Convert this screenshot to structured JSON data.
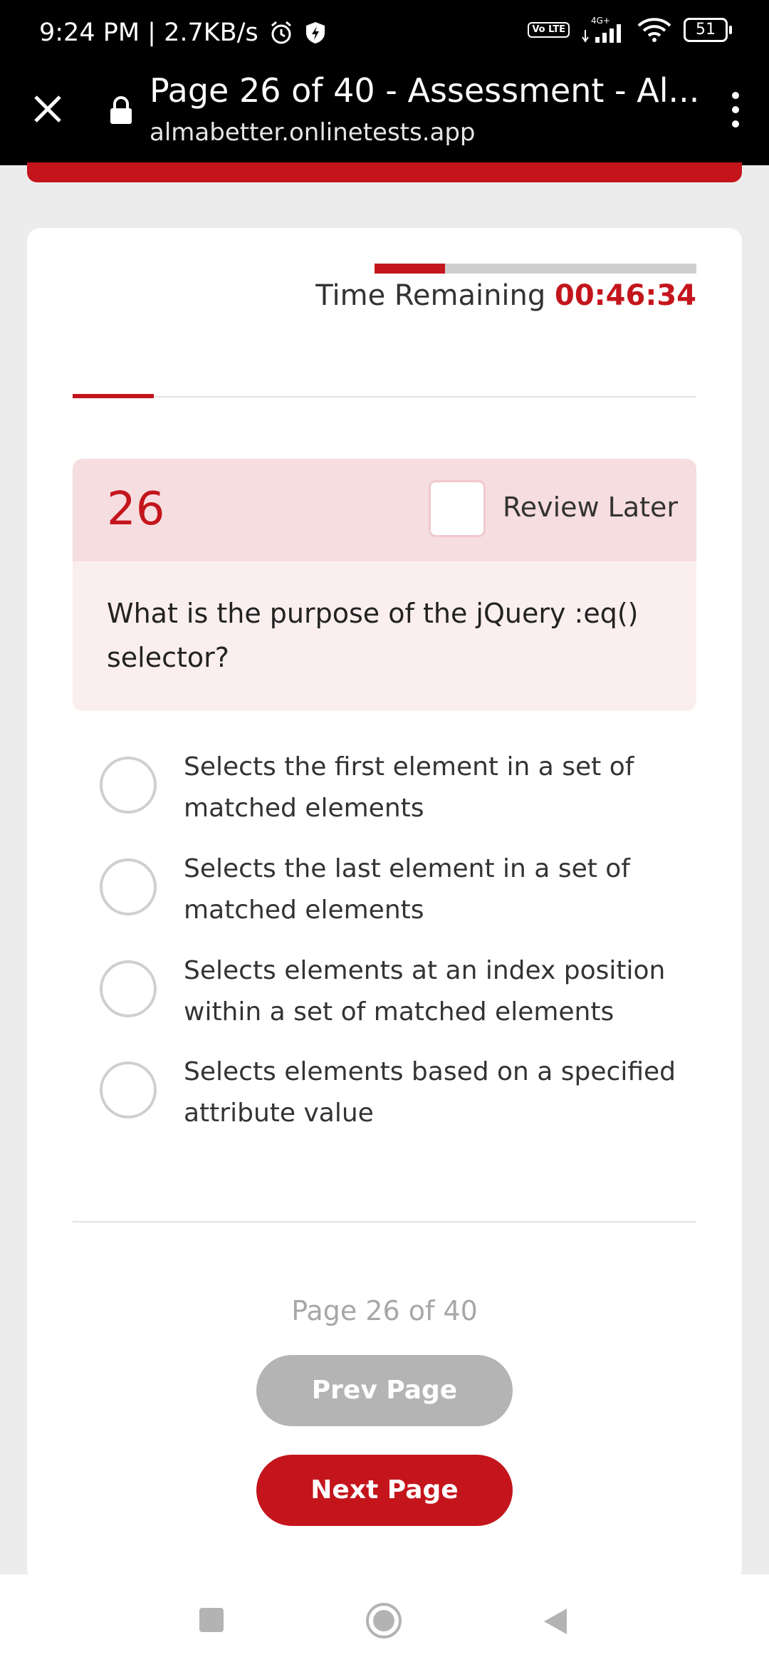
{
  "status_bar": {
    "time_speed": "9:24 PM | 2.7KB/s",
    "network": "4G+",
    "volte": "Vo LTE",
    "battery": "51"
  },
  "browser": {
    "title": "Page 26 of 40 - Assessment - Al...",
    "url": "almabetter.onlinetests.app"
  },
  "timer": {
    "label": "Time Remaining",
    "value": "00:46:34",
    "elapsed_fraction": 0.22
  },
  "question": {
    "number": "26",
    "review_label": "Review Later",
    "text": "What is the purpose of the jQuery :eq() selector?",
    "options": [
      "Selects the first element in a set of matched elements",
      "Selects the last element in a set of matched elements",
      "Selects elements at an index position within a set of matched elements",
      "Selects elements based on a specified attribute value"
    ]
  },
  "pagination": {
    "indicator": "Page 26 of 40",
    "prev_label": "Prev Page",
    "next_label": "Next Page"
  },
  "colors": {
    "accent": "#c4151c",
    "question_bg": "#fbeeef",
    "question_head_bg": "#f6dde0"
  }
}
